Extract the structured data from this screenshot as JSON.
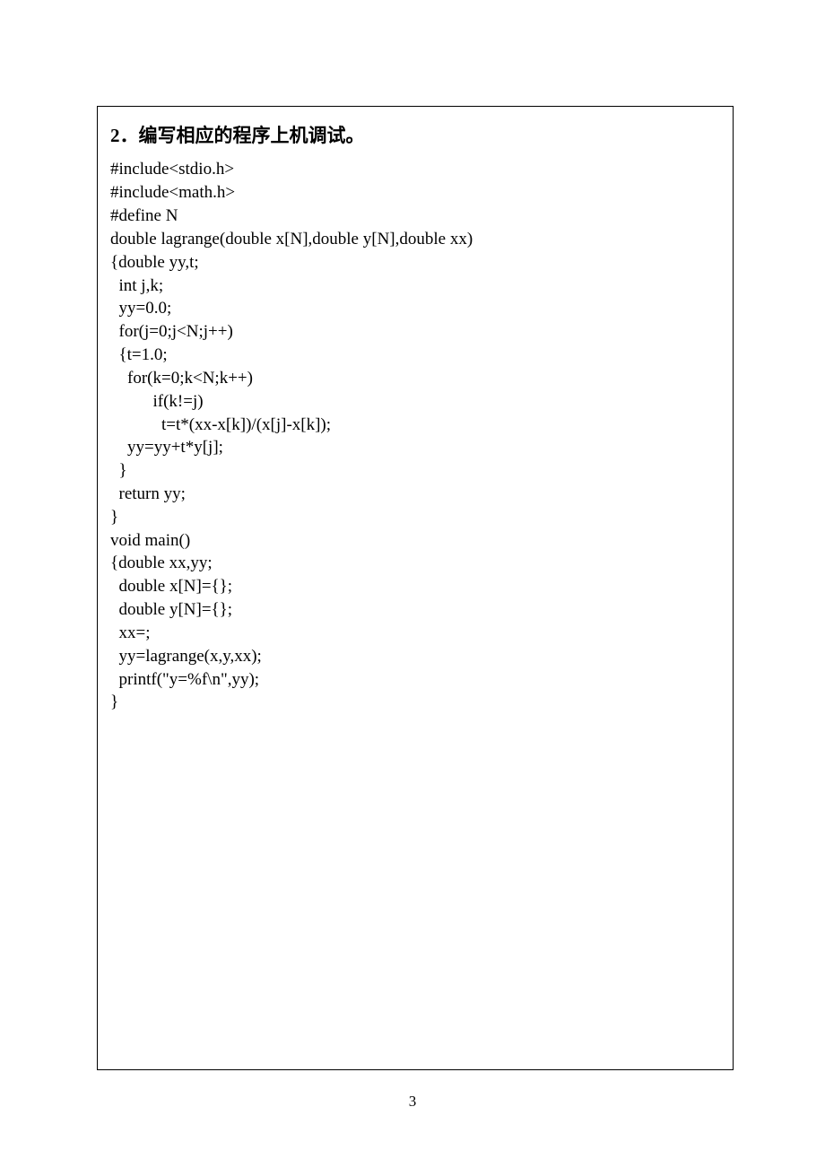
{
  "heading": "2．编写相应的程序上机调试。",
  "code_lines": [
    "#include<stdio.h>",
    "#include<math.h>",
    "#define N",
    "double lagrange(double x[N],double y[N],double xx)",
    "{double yy,t;",
    "  int j,k;",
    "  yy=0.0;",
    "  for(j=0;j<N;j++)",
    "  {t=1.0;",
    "    for(k=0;k<N;k++)",
    "          if(k!=j)",
    "            t=t*(xx-x[k])/(x[j]-x[k]);",
    "    yy=yy+t*y[j];",
    "  }",
    "  return yy;",
    "}",
    "void main()",
    "{double xx,yy;",
    "  double x[N]={};",
    "  double y[N]={};",
    "  xx=;",
    "  yy=lagrange(x,y,xx);",
    "  printf(\"y=%f\\n\",yy);",
    "}"
  ],
  "page_number": "3"
}
